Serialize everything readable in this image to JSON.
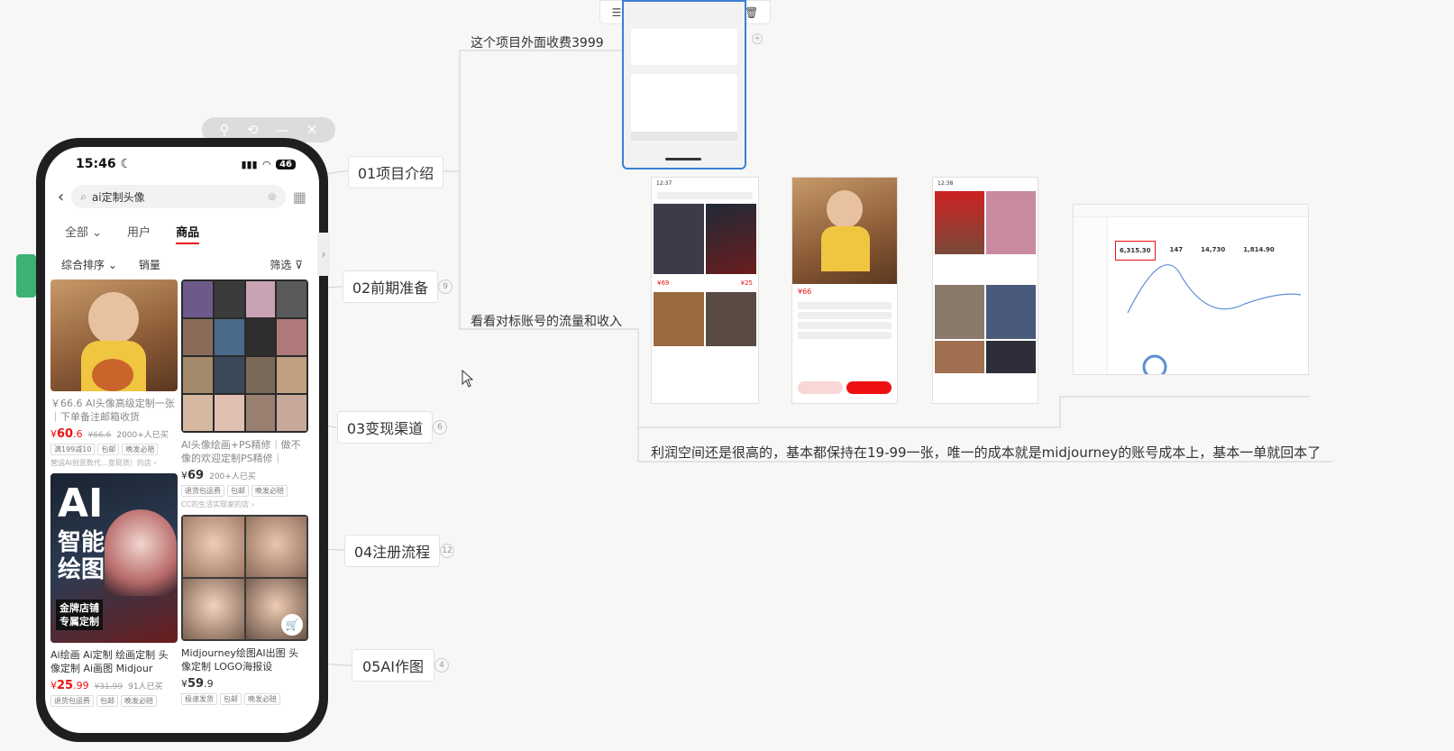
{
  "floating_bar": {
    "icons": [
      "pin-icon",
      "history-icon",
      "minimize-icon",
      "close-icon"
    ]
  },
  "phone": {
    "time": "15:46",
    "battery": "46",
    "search_query": "ai定制头像",
    "tabs": [
      "全部",
      "用户",
      "商品"
    ],
    "active_tab": "商品",
    "sort": {
      "primary": "综合排序",
      "sales": "销量",
      "filter": "筛选"
    },
    "products": [
      {
        "title": "￥66.6 AI头像高级定制一张｜下单备注邮箱收货",
        "price": "60",
        "price_dec": ".6",
        "orig": "¥66.6",
        "sold": "2000+人已买",
        "tags": [
          "满199减10",
          "包邮",
          "晚发必赔"
        ],
        "shop": "营运AI创意数代…变现货）的店 ›"
      },
      {
        "title": "AI头像绘画+PS精修｜做不像的欢迎定制PS精修｜",
        "price": "69",
        "price_dec": "",
        "orig": "",
        "sold": "200+人已买",
        "tags": [
          "退货包运费",
          "包邮",
          "晚发必赔"
        ],
        "shop": "CC的生活实现家的店 ›"
      },
      {
        "title": "Ai绘画 Ai定制 绘画定制 头像定制 Ai画图 Midjour",
        "price": "25",
        "price_dec": ".99",
        "orig": "¥31.99",
        "sold": "91人已买",
        "tags": [
          "退货包运费",
          "包邮",
          "晚发必赔"
        ],
        "shop": ""
      },
      {
        "title": "Midjourney绘图AI出图 头像定制 LOGO海报设",
        "price": "59",
        "price_dec": ".9",
        "orig": "",
        "sold": "",
        "tags": [
          "极速发货",
          "包邮",
          "晚发必赔"
        ],
        "shop": ""
      }
    ],
    "card3_overlay": {
      "big": "AI",
      "line1": "智能",
      "line2": "绘图",
      "badge1": "金牌店铺",
      "badge2": "专属定制"
    }
  },
  "mindmap": {
    "nodes": [
      {
        "label": "01项目介绍",
        "badge": ""
      },
      {
        "label": "02前期准备",
        "badge": "9"
      },
      {
        "label": "03变现渠道",
        "badge": "6"
      },
      {
        "label": "04注册流程",
        "badge": "12"
      },
      {
        "label": "05AI作图",
        "badge": "4"
      }
    ],
    "notes": {
      "fee": "这个项目外面收费3999",
      "traffic": "看看对标账号的流量和收入",
      "profit": "利润空间还是很高的，基本都保持在19-99一张，唯一的成本就是midjourney的账号成本上，基本一单就回本了"
    }
  },
  "toolbar_icons": [
    "align-icon",
    "frame-icon",
    "columns-icon",
    "split-icon",
    "delete-icon"
  ],
  "thumbs": {
    "chat_time": "12:37",
    "t1_time": "12:37",
    "t3_time": "12:38",
    "t1_price1": "¥69",
    "t1_price2": "¥25",
    "t2_price": "¥66",
    "dashboard_stats": [
      "6,315.30",
      "147",
      "14,730",
      "1,814.90"
    ]
  },
  "colors": {
    "accent_green": "#3bb273",
    "price_red": "#e11",
    "line": "#c8c8c8"
  }
}
